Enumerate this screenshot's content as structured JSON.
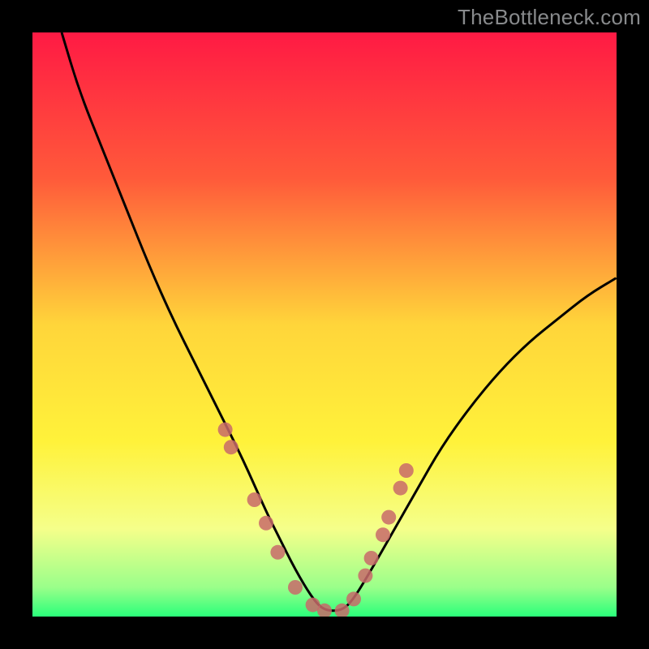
{
  "watermark": "TheBottleneck.com",
  "chart_data": {
    "type": "line",
    "title": "",
    "xlabel": "",
    "ylabel": "",
    "xlim": [
      0,
      100
    ],
    "ylim": [
      0,
      100
    ],
    "series": [
      {
        "name": "bottleneck-curve",
        "x": [
          5,
          8,
          12,
          16,
          20,
          24,
          28,
          32,
          36,
          40,
          42,
          45,
          48,
          50,
          53,
          55,
          58,
          62,
          66,
          70,
          75,
          80,
          85,
          90,
          95,
          100
        ],
        "y": [
          100,
          90,
          80,
          70,
          60,
          51,
          43,
          35,
          27,
          18,
          14,
          8,
          3,
          1,
          1,
          3,
          8,
          15,
          22,
          29,
          36,
          42,
          47,
          51,
          55,
          58
        ]
      }
    ],
    "dot_markers": {
      "name": "highlight-dots",
      "color": "#c86a6a",
      "x": [
        33,
        34,
        38,
        40,
        42,
        45,
        48,
        50,
        53,
        55,
        57,
        58,
        60,
        61,
        63,
        64
      ],
      "y": [
        32,
        29,
        20,
        16,
        11,
        5,
        2,
        1,
        1,
        3,
        7,
        10,
        14,
        17,
        22,
        25
      ]
    },
    "background_gradient": {
      "stops": [
        {
          "offset": 0,
          "color": "#ff1a44"
        },
        {
          "offset": 25,
          "color": "#ff5a3a"
        },
        {
          "offset": 50,
          "color": "#ffd53a"
        },
        {
          "offset": 70,
          "color": "#fff23a"
        },
        {
          "offset": 85,
          "color": "#f5ff8a"
        },
        {
          "offset": 95,
          "color": "#9aff8a"
        },
        {
          "offset": 100,
          "color": "#2aff7a"
        }
      ]
    }
  }
}
